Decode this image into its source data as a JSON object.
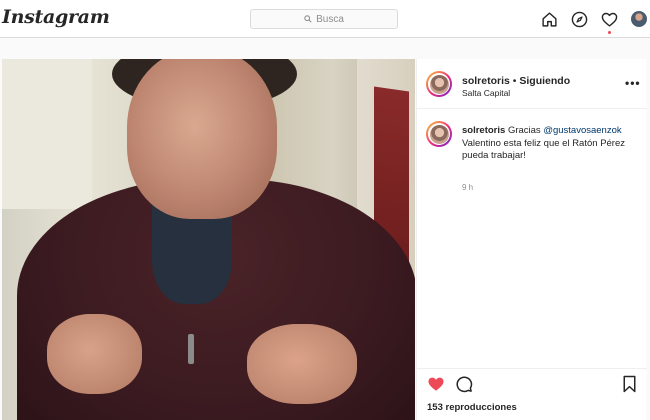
{
  "app": {
    "logo_text": "Instagram",
    "search_placeholder": "Busca"
  },
  "nav": {
    "icons": [
      "home-icon",
      "explore-compass-icon",
      "activity-heart-icon",
      "profile-avatar"
    ]
  },
  "post": {
    "header": {
      "username": "solretoris",
      "separator": "•",
      "follow_status": "Siguiendo",
      "location": "Salta Capital",
      "more_label": "•••"
    },
    "caption": {
      "username": "solretoris",
      "text_before": "Gracias ",
      "mention": "@gustavosaenzok",
      "text_after": " Valentino esta feliz que el Ratón Pérez pueda trabajar!",
      "time": "9 h"
    },
    "footer": {
      "views_count": "153",
      "views_label": "reproducciones",
      "liked": true
    }
  },
  "colors": {
    "like_red": "#ed4956",
    "mention_blue": "#00376b",
    "text": "#262626",
    "muted": "#8e8e8e"
  }
}
